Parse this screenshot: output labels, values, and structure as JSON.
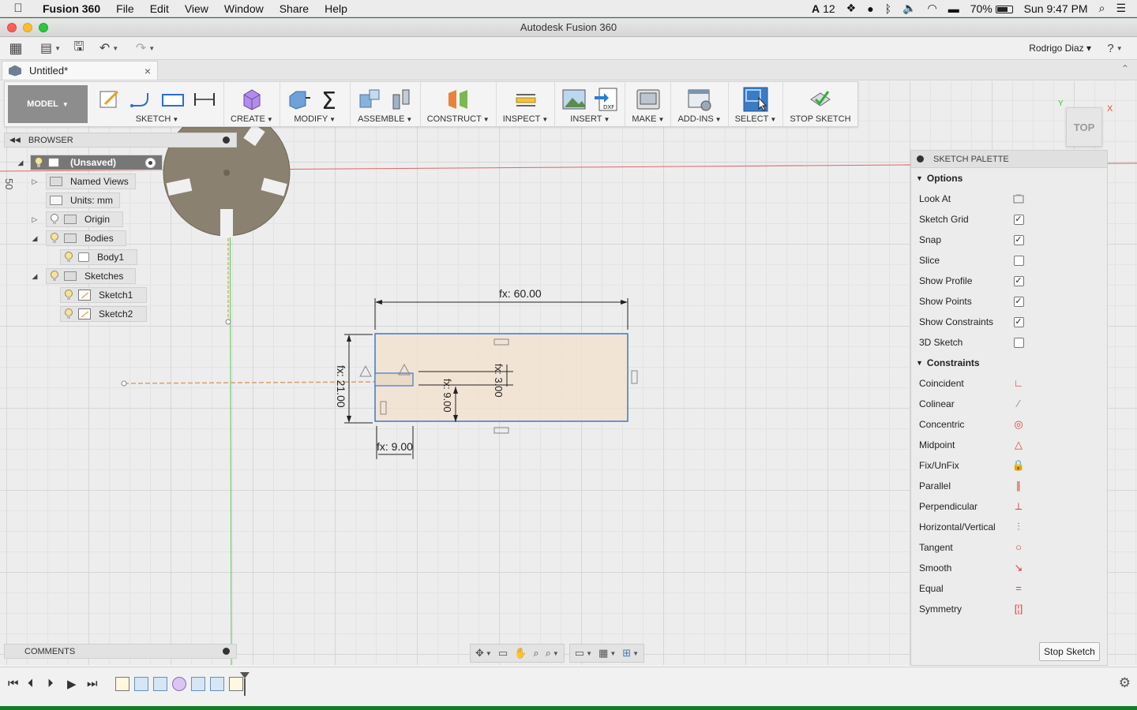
{
  "menubar": {
    "apple": "",
    "app_name": "Fusion 360",
    "items": [
      "File",
      "Edit",
      "View",
      "Window",
      "Share",
      "Help"
    ],
    "status": {
      "adobe": "12",
      "battery": "70%",
      "clock": "Sun 9:47 PM"
    }
  },
  "window": {
    "title": "Autodesk Fusion 360"
  },
  "qat": {
    "user": "Rodrigo Diaz ▾",
    "help": "?"
  },
  "doc_tab": {
    "label": "Untitled*",
    "close": "×"
  },
  "toolbar": {
    "workspace": "MODEL",
    "groups": [
      {
        "label": "SKETCH"
      },
      {
        "label": "CREATE"
      },
      {
        "label": "MODIFY"
      },
      {
        "label": "ASSEMBLE"
      },
      {
        "label": "CONSTRUCT"
      },
      {
        "label": "INSPECT"
      },
      {
        "label": "INSERT"
      },
      {
        "label": "MAKE"
      },
      {
        "label": "ADD-INS"
      },
      {
        "label": "SELECT"
      },
      {
        "label": "STOP SKETCH"
      }
    ]
  },
  "browser": {
    "title": "BROWSER",
    "items": [
      {
        "label": "(Unsaved)"
      },
      {
        "label": "Named Views"
      },
      {
        "label": "Units: mm"
      },
      {
        "label": "Origin"
      },
      {
        "label": "Bodies"
      },
      {
        "label": "Body1"
      },
      {
        "label": "Sketches"
      },
      {
        "label": "Sketch1"
      },
      {
        "label": "Sketch2"
      }
    ]
  },
  "canvas": {
    "side_label": "50",
    "dim_width": "fx: 60.00",
    "dim_height": "fx: 21.00",
    "dim_offset": "fx: 3.00",
    "dim_slot": "fx: 9.00",
    "dim_small": "fx: 9.00"
  },
  "viewcube": {
    "face": "TOP",
    "axis_x": "X",
    "axis_y": "Y"
  },
  "palette": {
    "title": "SKETCH PALETTE",
    "options_title": "Options",
    "options": [
      {
        "label": "Look At",
        "control": "icon"
      },
      {
        "label": "Sketch Grid",
        "control": "checked"
      },
      {
        "label": "Snap",
        "control": "checked"
      },
      {
        "label": "Slice",
        "control": "unchecked"
      },
      {
        "label": "Show Profile",
        "control": "checked"
      },
      {
        "label": "Show Points",
        "control": "checked"
      },
      {
        "label": "Show Constraints",
        "control": "checked"
      },
      {
        "label": "3D Sketch",
        "control": "unchecked"
      }
    ],
    "constraints_title": "Constraints",
    "constraints": [
      {
        "label": "Coincident",
        "icon": "coincident-icon"
      },
      {
        "label": "Colinear",
        "icon": "colinear-icon"
      },
      {
        "label": "Concentric",
        "icon": "concentric-icon"
      },
      {
        "label": "Midpoint",
        "icon": "midpoint-icon"
      },
      {
        "label": "Fix/UnFix",
        "icon": "lock-icon"
      },
      {
        "label": "Parallel",
        "icon": "parallel-icon"
      },
      {
        "label": "Perpendicular",
        "icon": "perpendicular-icon"
      },
      {
        "label": "Horizontal/Vertical",
        "icon": "horizontal-vertical-icon"
      },
      {
        "label": "Tangent",
        "icon": "tangent-icon"
      },
      {
        "label": "Smooth",
        "icon": "smooth-icon"
      },
      {
        "label": "Equal",
        "icon": "equal-icon"
      },
      {
        "label": "Symmetry",
        "icon": "symmetry-icon"
      }
    ],
    "stop_button": "Stop Sketch"
  },
  "comments": {
    "title": "COMMENTS"
  },
  "colors": {
    "accent_select": "#3a7bc8",
    "profile_fill": "#f2e2d0",
    "constraint_red": "#d8413a",
    "part_fill": "#8b8170"
  }
}
